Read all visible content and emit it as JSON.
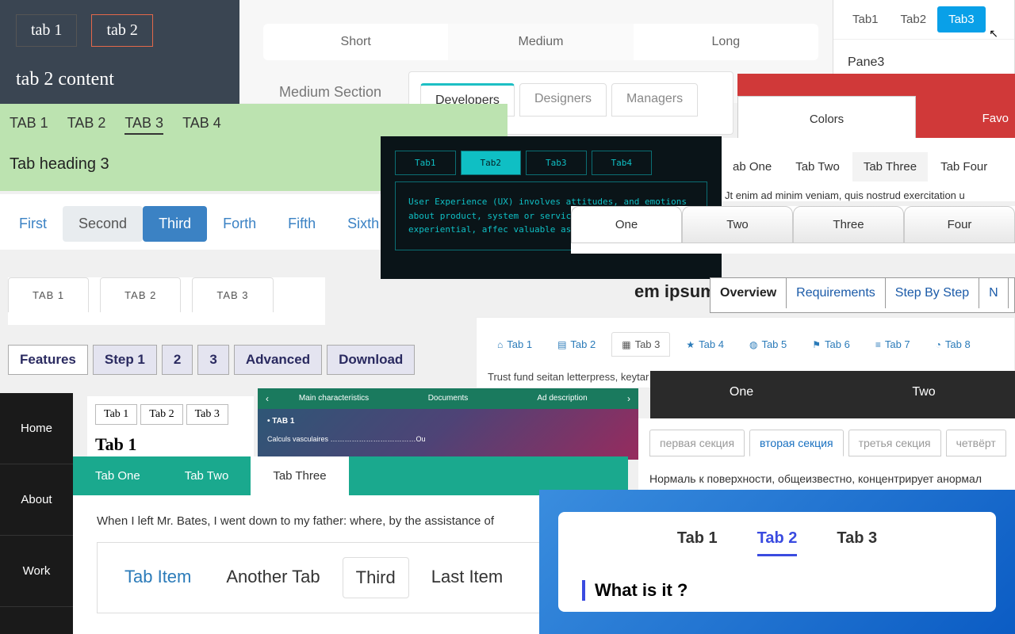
{
  "p1": {
    "tabs": [
      "tab 1",
      "tab 2"
    ],
    "active": 1,
    "content": "tab 2 content"
  },
  "p2": {
    "tabs": [
      "Short",
      "Medium",
      "Long"
    ],
    "active": 1,
    "section": "Medium Section"
  },
  "p3": {
    "tabs": [
      "Tab1",
      "Tab2",
      "Tab3"
    ],
    "active": 2,
    "content": "Pane3"
  },
  "p4": {
    "box": "Colors",
    "fav": "Favo"
  },
  "p5": {
    "tabs": [
      "Developers",
      "Designers",
      "Managers"
    ],
    "active": 0
  },
  "p6": {
    "tabs": [
      "TAB 1",
      "TAB 2",
      "TAB 3",
      "TAB 4"
    ],
    "active": 2,
    "heading": "Tab heading 3"
  },
  "p7": {
    "tabs": [
      "Tab1",
      "Tab2",
      "Tab3",
      "Tab4"
    ],
    "active": 1,
    "content": "User Experience (UX) involves attitudes, and emotions about product, system or service. Use the practical, experiential, affec valuable aspects of human-com"
  },
  "p8": {
    "tabs": [
      "First",
      "Second",
      "Third",
      "Forth",
      "Fifth",
      "Sixth"
    ],
    "grey": 1,
    "active": 2
  },
  "p9": {
    "tabs": [
      "ab One",
      "Tab Two",
      "Tab Three",
      "Tab Four"
    ],
    "active": 2,
    "text": "Jt enim ad minim veniam, quis nostrud exercitation u"
  },
  "p10": {
    "tabs": [
      "One",
      "Two",
      "Three",
      "Four"
    ],
    "active": 0
  },
  "p11": {
    "tabs": [
      "TAB 1",
      "TAB 2",
      "TAB 3"
    ]
  },
  "p12": {
    "text": "em ipsum"
  },
  "p13": {
    "tabs": [
      "Overview",
      "Requirements",
      "Step By Step",
      "N"
    ],
    "active": 0
  },
  "p14": {
    "tabs": [
      {
        "icon": "⌂",
        "label": "Tab 1"
      },
      {
        "icon": "▤",
        "label": "Tab 2"
      },
      {
        "icon": "▦",
        "label": "Tab 3"
      },
      {
        "icon": "★",
        "label": "Tab 4"
      },
      {
        "icon": "◍",
        "label": "Tab 5"
      },
      {
        "icon": "⚑",
        "label": "Tab 6"
      },
      {
        "icon": "≡",
        "label": "Tab 7"
      },
      {
        "icon": "◔",
        "label": "Tab 8"
      }
    ],
    "active": 2,
    "text": "Trust fund seitan letterpress, keytar raw cosby sweater. Fanny pack portland se"
  },
  "p15": {
    "tabs": [
      "Features",
      "Step 1",
      "2",
      "3",
      "Advanced",
      "Download"
    ],
    "active": 0
  },
  "p16": {
    "tabs": [
      "Tab 1",
      "Tab 2",
      "Tab 3"
    ],
    "heading": "Tab 1"
  },
  "p17": {
    "items": [
      "Home",
      "About",
      "Work"
    ],
    "active": 1
  },
  "p18": {
    "tabs": [
      "Main characteristics",
      "Documents",
      "Ad description"
    ],
    "caption": "• TAB 1",
    "sub": "Calculs vasculaires ………………………………Ou"
  },
  "p19": {
    "tabs": [
      "One",
      "Two"
    ]
  },
  "p20": {
    "tabs": [
      "первая секция",
      "вторая секция",
      "третья секция",
      "четвёрт"
    ],
    "active": 1,
    "text": "Нормаль к поверхности, общеизвестно, концентрирует анормал"
  },
  "p21": {
    "tabs": [
      "Tab One",
      "Tab Two",
      "Tab Three"
    ],
    "active": 2,
    "text": "When I left Mr. Bates, I went down to my father: where, by the assistance of",
    "subtabs": [
      "Tab Item",
      "Another Tab",
      "Third",
      "Last Item"
    ],
    "subactive": 2
  },
  "p22": {
    "tabs": [
      "Tab 1",
      "Tab 2",
      "Tab 3"
    ],
    "active": 1,
    "heading": "What is it ?"
  }
}
